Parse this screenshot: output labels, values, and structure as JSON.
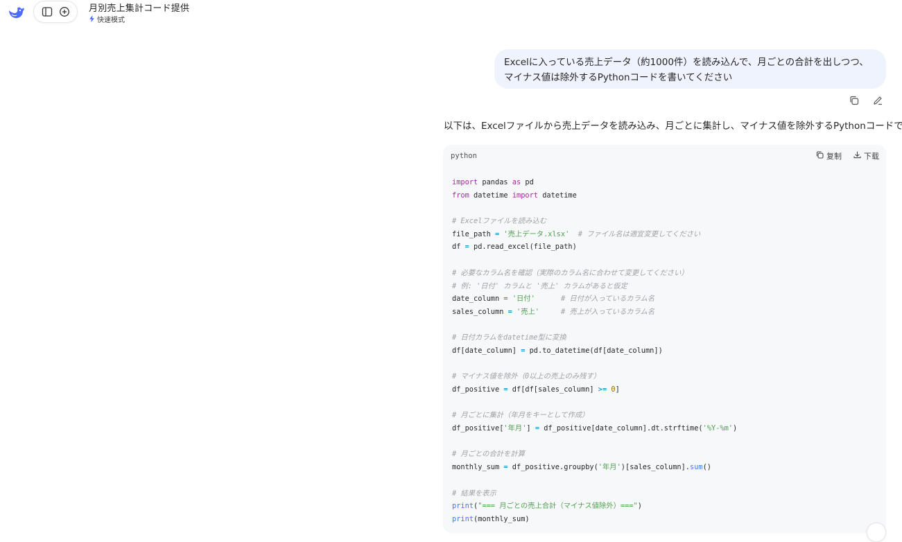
{
  "header": {
    "title": "月別売上集計コード提供",
    "mode_label": "快速模式"
  },
  "icons": {
    "logo": "deepseek-whale-logo",
    "sidebar_toggle": "sidebar-toggle-icon",
    "new_chat": "new-chat-plus-icon",
    "mode": "lightning-icon",
    "copy": "copy-icon",
    "edit": "edit-pencil-icon",
    "download": "download-icon"
  },
  "colors": {
    "accent": "#4d6bfe",
    "bubble": "#eef3fd",
    "code_bg": "#f7f8fa"
  },
  "conversation": {
    "user_message": "Excelに入っている売上データ（約1000件）を読み込んで、月ごとの合計を出しつつ、マイナス値は除外するPythonコードを書いてください",
    "assistant_intro": "以下は、Excelファイルから売上データを読み込み、月ごとに集計し、マイナス値を除外するPythonコードです。"
  },
  "code": {
    "language": "python",
    "copy_label": "复制",
    "download_label": "下载",
    "lines": [
      [
        {
          "t": "kw",
          "v": "import"
        },
        {
          "t": "",
          "v": " pandas "
        },
        {
          "t": "kw",
          "v": "as"
        },
        {
          "t": "",
          "v": " pd"
        }
      ],
      [
        {
          "t": "kw",
          "v": "from"
        },
        {
          "t": "",
          "v": " datetime "
        },
        {
          "t": "kw",
          "v": "import"
        },
        {
          "t": "",
          "v": " datetime"
        }
      ],
      [],
      [
        {
          "t": "cm",
          "v": "# Excelファイルを読み込む"
        }
      ],
      [
        {
          "t": "",
          "v": "file_path "
        },
        {
          "t": "op",
          "v": "="
        },
        {
          "t": "",
          "v": " "
        },
        {
          "t": "str",
          "v": "'売上データ.xlsx'"
        },
        {
          "t": "",
          "v": "  "
        },
        {
          "t": "cm",
          "v": "# ファイル名は適宜変更してください"
        }
      ],
      [
        {
          "t": "",
          "v": "df "
        },
        {
          "t": "op",
          "v": "="
        },
        {
          "t": "",
          "v": " pd.read_excel(file_path)"
        }
      ],
      [],
      [
        {
          "t": "cm",
          "v": "# 必要なカラム名を確認（実際のカラム名に合わせて変更してください）"
        }
      ],
      [
        {
          "t": "cm",
          "v": "# 例: '日付' カラムと '売上' カラムがあると仮定"
        }
      ],
      [
        {
          "t": "",
          "v": "date_column "
        },
        {
          "t": "op",
          "v": "="
        },
        {
          "t": "",
          "v": " "
        },
        {
          "t": "str",
          "v": "'日付'"
        },
        {
          "t": "",
          "v": "      "
        },
        {
          "t": "cm",
          "v": "# 日付が入っているカラム名"
        }
      ],
      [
        {
          "t": "",
          "v": "sales_column "
        },
        {
          "t": "op",
          "v": "="
        },
        {
          "t": "",
          "v": " "
        },
        {
          "t": "str",
          "v": "'売上'"
        },
        {
          "t": "",
          "v": "     "
        },
        {
          "t": "cm",
          "v": "# 売上が入っているカラム名"
        }
      ],
      [],
      [
        {
          "t": "cm",
          "v": "# 日付カラムをdatetime型に変換"
        }
      ],
      [
        {
          "t": "",
          "v": "df[date_column] "
        },
        {
          "t": "op",
          "v": "="
        },
        {
          "t": "",
          "v": " pd.to_datetime(df[date_column])"
        }
      ],
      [],
      [
        {
          "t": "cm",
          "v": "# マイナス値を除外（0以上の売上のみ残す）"
        }
      ],
      [
        {
          "t": "",
          "v": "df_positive "
        },
        {
          "t": "op",
          "v": "="
        },
        {
          "t": "",
          "v": " df[df[sales_column] "
        },
        {
          "t": "op",
          "v": ">="
        },
        {
          "t": "",
          "v": " "
        },
        {
          "t": "num",
          "v": "0"
        },
        {
          "t": "",
          "v": "]"
        }
      ],
      [],
      [
        {
          "t": "cm",
          "v": "# 月ごとに集計（年月をキーとして作成）"
        }
      ],
      [
        {
          "t": "",
          "v": "df_positive["
        },
        {
          "t": "str",
          "v": "'年月'"
        },
        {
          "t": "",
          "v": "] "
        },
        {
          "t": "op",
          "v": "="
        },
        {
          "t": "",
          "v": " df_positive[date_column].dt.strftime("
        },
        {
          "t": "str",
          "v": "'%Y-%m'"
        },
        {
          "t": "",
          "v": ")"
        }
      ],
      [],
      [
        {
          "t": "cm",
          "v": "# 月ごとの合計を計算"
        }
      ],
      [
        {
          "t": "",
          "v": "monthly_sum "
        },
        {
          "t": "op",
          "v": "="
        },
        {
          "t": "",
          "v": " df_positive.groupby("
        },
        {
          "t": "str",
          "v": "'年月'"
        },
        {
          "t": "",
          "v": ")[sales_column]."
        },
        {
          "t": "fn",
          "v": "sum"
        },
        {
          "t": "",
          "v": "()"
        }
      ],
      [],
      [
        {
          "t": "cm",
          "v": "# 結果を表示"
        }
      ],
      [
        {
          "t": "fn",
          "v": "print"
        },
        {
          "t": "",
          "v": "("
        },
        {
          "t": "str",
          "v": "\"=== 月ごとの売上合計（マイナス値除外）===\""
        },
        {
          "t": "",
          "v": ")"
        }
      ],
      [
        {
          "t": "fn",
          "v": "print"
        },
        {
          "t": "",
          "v": "(monthly_sum)"
        }
      ]
    ]
  }
}
